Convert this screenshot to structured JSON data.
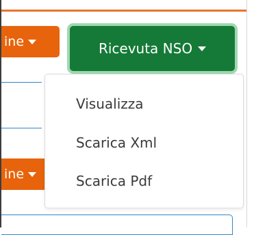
{
  "toolbar": {
    "order_button_label": "ine",
    "receipt_button_label": "Ricevuta NSO"
  },
  "receipt_menu": {
    "items": [
      {
        "label": "Visualizza"
      },
      {
        "label": "Scarica Xml"
      },
      {
        "label": "Scarica Pdf"
      }
    ]
  },
  "second_row": {
    "order_button_label": "ine"
  },
  "colors": {
    "accent_orange": "#e8640c",
    "accent_green": "#157a37",
    "focus_ring": "#9fd8b0",
    "line_blue": "#2e86c8"
  }
}
